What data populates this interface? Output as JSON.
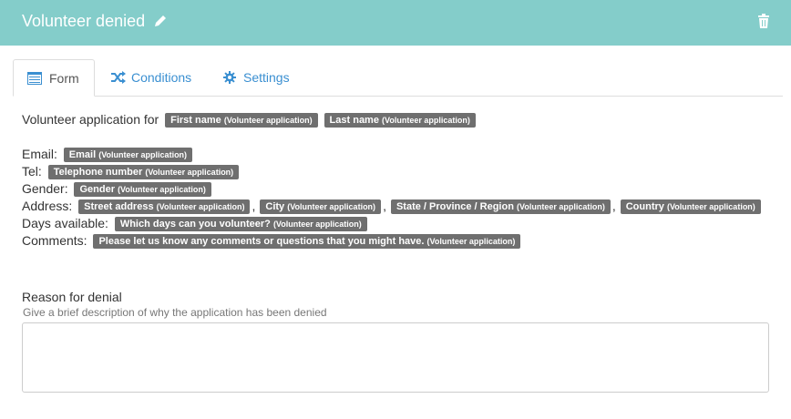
{
  "header": {
    "title": "Volunteer denied",
    "edit_icon": "pencil-icon",
    "delete_icon": "trash-icon",
    "bg_color": "#84cdca"
  },
  "tabs": [
    {
      "label": "Form",
      "icon": "form-icon",
      "active": true
    },
    {
      "label": "Conditions",
      "icon": "shuffle-icon",
      "active": false
    },
    {
      "label": "Settings",
      "icon": "gear-icon",
      "active": false
    }
  ],
  "form": {
    "intro": "Volunteer application for",
    "intro_tags": [
      {
        "field": "First name",
        "source": "(Volunteer application)"
      },
      {
        "field": "Last name",
        "source": "(Volunteer application)"
      }
    ],
    "lines": [
      {
        "label": "Email:",
        "tags": [
          {
            "field": "Email",
            "source": "(Volunteer application)"
          }
        ]
      },
      {
        "label": "Tel:",
        "tags": [
          {
            "field": "Telephone number",
            "source": "(Volunteer application)"
          }
        ]
      },
      {
        "label": "Gender:",
        "tags": [
          {
            "field": "Gender",
            "source": "(Volunteer application)"
          }
        ]
      },
      {
        "label": "Address:",
        "tags": [
          {
            "field": "Street address",
            "source": "(Volunteer application)"
          },
          {
            "field": "City",
            "source": "(Volunteer application)"
          },
          {
            "field": "State / Province / Region",
            "source": "(Volunteer application)"
          },
          {
            "field": "Country",
            "source": "(Volunteer application)"
          }
        ]
      },
      {
        "label": "Days available:",
        "tags": [
          {
            "field": "Which days can you volunteer?",
            "source": "(Volunteer application)"
          }
        ]
      },
      {
        "label": "Comments:",
        "tags": [
          {
            "field": "Please let us know any comments or questions that you might have.",
            "source": "(Volunteer application)"
          }
        ]
      }
    ],
    "separator": ","
  },
  "reason": {
    "label": "Reason for denial",
    "help": "Give a brief description of why the application has been denied",
    "value": ""
  }
}
